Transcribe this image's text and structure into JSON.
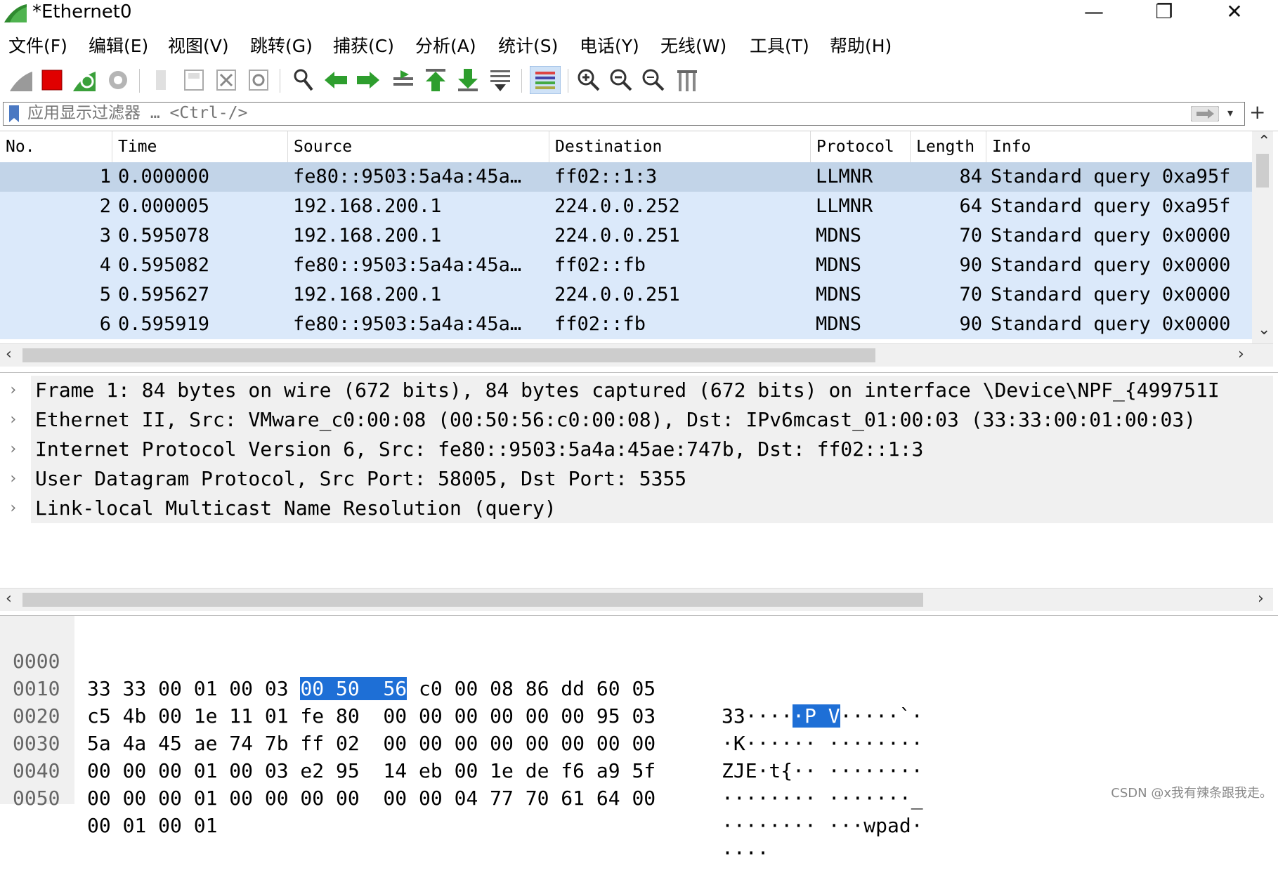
{
  "window": {
    "title": "*Ethernet0",
    "minimize_icon": "—",
    "maximize_icon": "❐",
    "close_icon": "✕"
  },
  "menu": [
    "文件(F)",
    "编辑(E)",
    "视图(V)",
    "跳转(G)",
    "捕获(C)",
    "分析(A)",
    "统计(S)",
    "电话(Y)",
    "无线(W)",
    "工具(T)",
    "帮助(H)"
  ],
  "filter": {
    "placeholder": "应用显示过滤器 … <Ctrl-/>"
  },
  "packet_list": {
    "columns": [
      "No.",
      "Time",
      "Source",
      "Destination",
      "Protocol",
      "Length",
      "Info"
    ],
    "rows": [
      {
        "no": "1",
        "time": "0.000000",
        "source": "fe80::9503:5a4a:45a…",
        "destination": "ff02::1:3",
        "protocol": "LLMNR",
        "length": "84",
        "info": "Standard query 0xa95f"
      },
      {
        "no": "2",
        "time": "0.000005",
        "source": "192.168.200.1",
        "destination": "224.0.0.252",
        "protocol": "LLMNR",
        "length": "64",
        "info": "Standard query 0xa95f"
      },
      {
        "no": "3",
        "time": "0.595078",
        "source": "192.168.200.1",
        "destination": "224.0.0.251",
        "protocol": "MDNS",
        "length": "70",
        "info": "Standard query 0x0000"
      },
      {
        "no": "4",
        "time": "0.595082",
        "source": "fe80::9503:5a4a:45a…",
        "destination": "ff02::fb",
        "protocol": "MDNS",
        "length": "90",
        "info": "Standard query 0x0000"
      },
      {
        "no": "5",
        "time": "0.595627",
        "source": "192.168.200.1",
        "destination": "224.0.0.251",
        "protocol": "MDNS",
        "length": "70",
        "info": "Standard query 0x0000"
      },
      {
        "no": "6",
        "time": "0.595919",
        "source": "fe80::9503:5a4a:45a…",
        "destination": "ff02::fb",
        "protocol": "MDNS",
        "length": "90",
        "info": "Standard query 0x0000"
      }
    ]
  },
  "details": [
    "Frame 1: 84 bytes on wire (672 bits), 84 bytes captured (672 bits) on interface \\Device\\NPF_{499751I",
    "Ethernet II, Src: VMware_c0:00:08 (00:50:56:c0:00:08), Dst: IPv6mcast_01:00:03 (33:33:00:01:00:03)",
    "Internet Protocol Version 6, Src: fe80::9503:5a4a:45ae:747b, Dst: ff02::1:3",
    "User Datagram Protocol, Src Port: 58005, Dst Port: 5355",
    "Link-local Multicast Name Resolution (query)"
  ],
  "bytes": [
    {
      "offset": "0000",
      "hex_a": "33 33 00 01 00 03 ",
      "hex_hl": "00 50  56",
      "hex_b": " c0 00 08 86 dd 60 05",
      "ascii_a": "33····",
      "ascii_hl": "·P V",
      "ascii_b": "·····`·"
    },
    {
      "offset": "0010",
      "hex_a": "c5 4b 00 1e 11 01 fe 80  00 00 00 00 00 00 95 03",
      "hex_hl": "",
      "hex_b": "",
      "ascii_a": "·K······ ········",
      "ascii_hl": "",
      "ascii_b": ""
    },
    {
      "offset": "0020",
      "hex_a": "5a 4a 45 ae 74 7b ff 02  00 00 00 00 00 00 00 00",
      "hex_hl": "",
      "hex_b": "",
      "ascii_a": "ZJE·t{·· ········",
      "ascii_hl": "",
      "ascii_b": ""
    },
    {
      "offset": "0030",
      "hex_a": "00 00 00 01 00 03 e2 95  14 eb 00 1e de f6 a9 5f",
      "hex_hl": "",
      "hex_b": "",
      "ascii_a": "········ ·······_",
      "ascii_hl": "",
      "ascii_b": ""
    },
    {
      "offset": "0040",
      "hex_a": "00 00 00 01 00 00 00 00  00 00 04 77 70 61 64 00",
      "hex_hl": "",
      "hex_b": "",
      "ascii_a": "········ ···wpad·",
      "ascii_hl": "",
      "ascii_b": ""
    },
    {
      "offset": "0050",
      "hex_a": "00 01 00 01",
      "hex_hl": "",
      "hex_b": "",
      "ascii_a": "····",
      "ascii_hl": "",
      "ascii_b": ""
    }
  ],
  "watermark": "CSDN @x我有辣条跟我走。",
  "colors": {
    "row_bg": "#dbe9fa",
    "row_selected_bg": "#c2d4e8",
    "byte_highlight": "#1e6fd6",
    "detail_bg": "#f0f0f0"
  }
}
